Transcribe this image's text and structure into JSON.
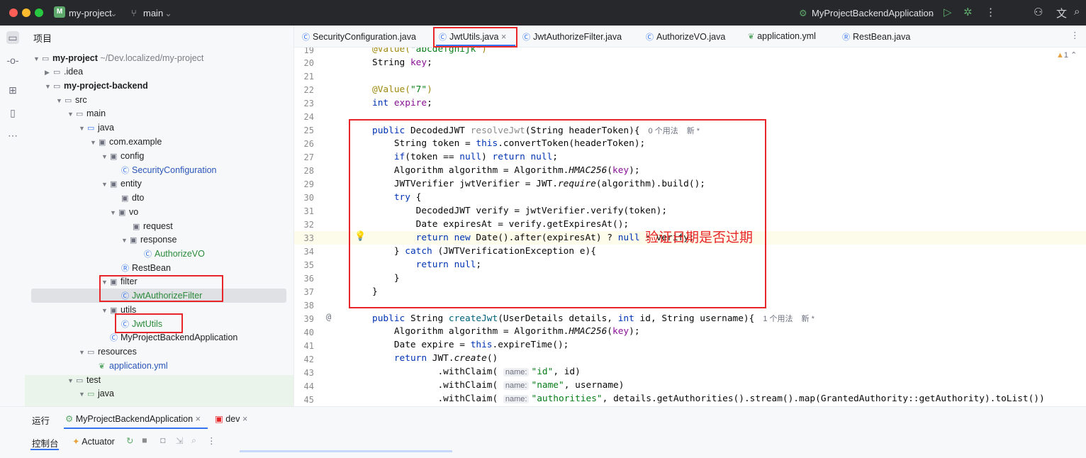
{
  "titlebar": {
    "project_badge": "M",
    "project_name": "my-project",
    "branch_icon": "branch-icon",
    "branch": "main",
    "run_config": "MyProjectBackendApplication"
  },
  "project_panel": {
    "header": "项目",
    "tree": [
      {
        "label": "my-project",
        "extra": "~/Dev.localized/my-project"
      },
      {
        "label": ".idea"
      },
      {
        "label": "my-project-backend"
      },
      {
        "label": "src"
      },
      {
        "label": "main"
      },
      {
        "label": "java"
      },
      {
        "label": "com.example"
      },
      {
        "label": "config"
      },
      {
        "label": "SecurityConfiguration"
      },
      {
        "label": "entity"
      },
      {
        "label": "dto"
      },
      {
        "label": "vo"
      },
      {
        "label": "request"
      },
      {
        "label": "response"
      },
      {
        "label": "AuthorizeVO"
      },
      {
        "label": "RestBean"
      },
      {
        "label": "filter"
      },
      {
        "label": "JwtAuthorizeFilter"
      },
      {
        "label": "utils"
      },
      {
        "label": "JwtUtils"
      },
      {
        "label": "MyProjectBackendApplication"
      },
      {
        "label": "resources"
      },
      {
        "label": "application.yml"
      },
      {
        "label": "test"
      },
      {
        "label": "java"
      }
    ]
  },
  "tabs": [
    {
      "label": "SecurityConfiguration.java"
    },
    {
      "label": "JwtUtils.java",
      "close": "×"
    },
    {
      "label": "JwtAuthorizeFilter.java"
    },
    {
      "label": "AuthorizeVO.java"
    },
    {
      "label": "application.yml"
    },
    {
      "label": "RestBean.java"
    }
  ],
  "editor": {
    "warning_count": "1",
    "line_numbers": [
      "19",
      "20",
      "21",
      "22",
      "23",
      "24",
      "25",
      "26",
      "27",
      "28",
      "29",
      "30",
      "31",
      "32",
      "33",
      "34",
      "35",
      "36",
      "37",
      "38",
      "39",
      "40",
      "41",
      "42",
      "43",
      "44",
      "45"
    ],
    "hint_usages_0": "0 个用法",
    "hint_usages_1": "1 个用法",
    "hint_new": "新 *",
    "param_name": "name:",
    "annotation_overlay": "验证日期是否过期"
  },
  "bottom": {
    "run_label": "运行",
    "run_tab": "MyProjectBackendApplication",
    "dev_tab": "dev",
    "console_label": "控制台",
    "actuator_label": "Actuator"
  },
  "colors": {
    "accent": "#3574f0",
    "annotation_red": "#e8262a",
    "titlebar_bg": "#27282c"
  }
}
